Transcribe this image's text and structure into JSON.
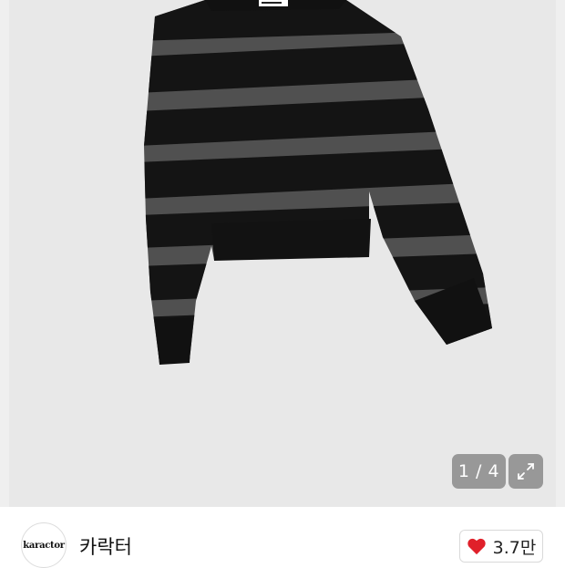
{
  "gallery": {
    "image_subject": "striped-sweater",
    "counter": "1 / 4",
    "expand_icon": "expand-arrows-icon"
  },
  "shop": {
    "logo_text": "karactor",
    "name": "카락터",
    "like_icon": "heart-icon",
    "like_color": "#e0202a",
    "like_count": "3.7만"
  }
}
